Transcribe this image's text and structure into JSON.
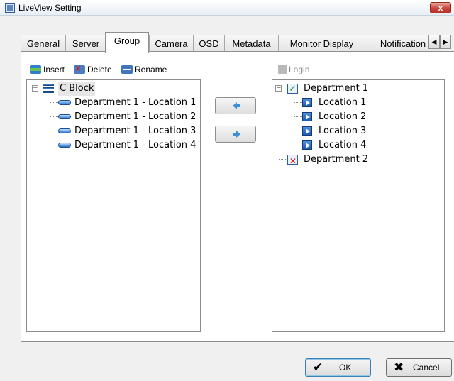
{
  "window": {
    "title": "LiveView Setting",
    "close_glyph": "x"
  },
  "tabs": [
    {
      "label": "General"
    },
    {
      "label": "Server"
    },
    {
      "label": "Group"
    },
    {
      "label": "Camera"
    },
    {
      "label": "OSD"
    },
    {
      "label": "Metadata"
    },
    {
      "label": "Monitor Display"
    },
    {
      "label": "Notification"
    }
  ],
  "active_tab": "Group",
  "tab_scroll": {
    "left": "◀",
    "right": "▶"
  },
  "toolbar": {
    "insert": "Insert",
    "delete": "Delete",
    "rename": "Rename",
    "login": "Login"
  },
  "left_tree": {
    "root": {
      "label": "C Block",
      "expander": "−"
    },
    "children": [
      "Department 1 - Location 1",
      "Department 1 - Location 2",
      "Department 1 - Location 3",
      "Department 1 - Location 4"
    ]
  },
  "right_tree": {
    "nodes": [
      {
        "label": "Department 1",
        "expander": "−"
      },
      {
        "label": "Location 1"
      },
      {
        "label": "Location 2"
      },
      {
        "label": "Location 3"
      },
      {
        "label": "Location 4"
      },
      {
        "label": "Department 2"
      }
    ]
  },
  "buttons": {
    "ok": "OK",
    "ok_glyph": "✔",
    "cancel": "Cancel",
    "cancel_glyph": "✖"
  },
  "colors": {
    "accent": "#3d8fd8",
    "close": "#c9453a"
  }
}
